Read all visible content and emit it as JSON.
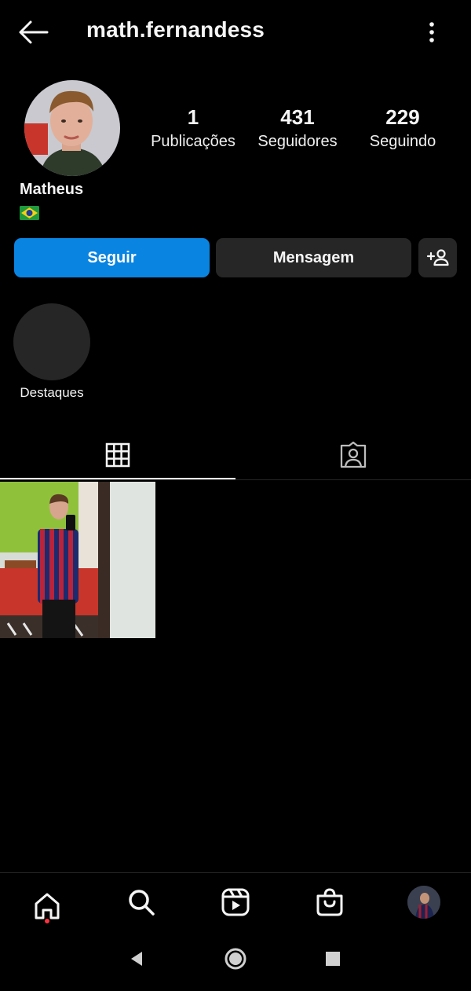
{
  "header": {
    "username": "math.fernandess"
  },
  "profile": {
    "display_name": "Matheus",
    "stats": [
      {
        "value": "1",
        "label": "Publicações"
      },
      {
        "value": "431",
        "label": "Seguidores"
      },
      {
        "value": "229",
        "label": "Seguindo"
      }
    ]
  },
  "actions": {
    "follow_label": "Seguir",
    "message_label": "Mensagem"
  },
  "highlights": {
    "label": "Destaques"
  },
  "colors": {
    "accent": "#0a84e1",
    "background": "#000000",
    "secondary_button": "#262626",
    "notification_dot": "#ff3040"
  }
}
